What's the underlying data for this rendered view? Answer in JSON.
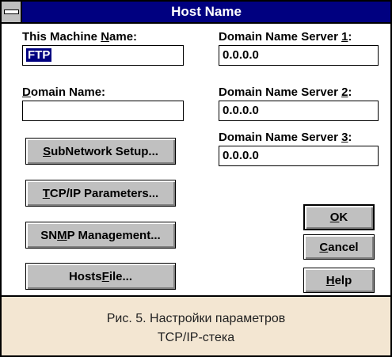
{
  "window": {
    "title": "Host Name"
  },
  "left": {
    "machine_name_label_pre": "This Machine ",
    "machine_name_label_key": "N",
    "machine_name_label_post": "ame:",
    "machine_name_value": "FTP",
    "domain_name_label_key": "D",
    "domain_name_label_post": "omain Name:",
    "domain_name_value": ""
  },
  "dns": [
    {
      "label_pre": "Domain Name Server ",
      "label_key": "1",
      "label_post": ":",
      "value": "0.0.0.0"
    },
    {
      "label_pre": "Domain Name Server ",
      "label_key": "2",
      "label_post": ":",
      "value": "0.0.0.0"
    },
    {
      "label_pre": "Domain Name Server ",
      "label_key": "3",
      "label_post": ":",
      "value": "0.0.0.0"
    }
  ],
  "buttons": {
    "subnetwork": {
      "key": "S",
      "post": "ubNetwork Setup..."
    },
    "tcpip": {
      "key": "T",
      "post": "CP/IP Parameters..."
    },
    "snmp": {
      "pre": "SN",
      "key": "M",
      "post": "P Management..."
    },
    "hosts": {
      "pre": "Hosts ",
      "key": "F",
      "post": "ile..."
    },
    "ok": {
      "key": "O",
      "post": "K"
    },
    "cancel": {
      "key": "C",
      "post": "ancel"
    },
    "help": {
      "key": "H",
      "post": "elp"
    }
  },
  "caption": {
    "line1": "Рис. 5. Настройки параметров",
    "line2": "TCP/IP-стека"
  }
}
